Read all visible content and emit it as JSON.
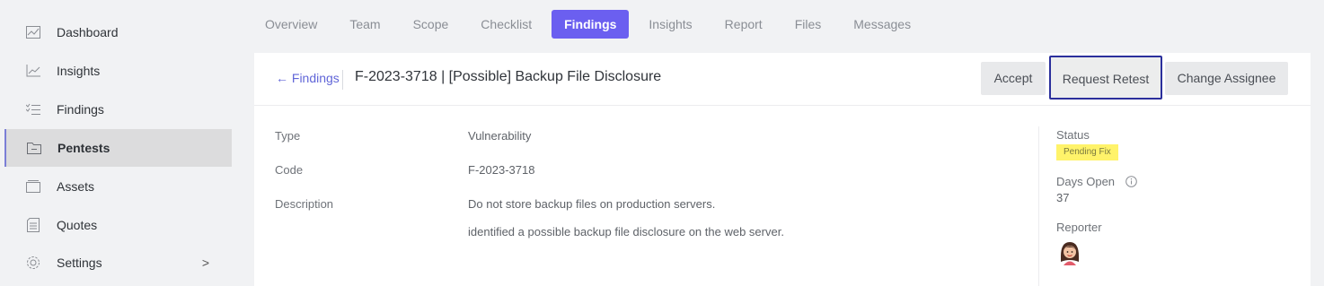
{
  "sidebar": {
    "items": [
      {
        "label": "Dashboard",
        "icon": "dashboard-icon"
      },
      {
        "label": "Insights",
        "icon": "chart-line-icon"
      },
      {
        "label": "Findings",
        "icon": "checklist-icon"
      },
      {
        "label": "Pentests",
        "icon": "folder-icon",
        "active": true
      },
      {
        "label": "Assets",
        "icon": "assets-icon"
      },
      {
        "label": "Quotes",
        "icon": "quotes-icon"
      },
      {
        "label": "Settings",
        "icon": "gear-icon",
        "chevron": ">"
      }
    ]
  },
  "tabs": [
    {
      "label": "Overview"
    },
    {
      "label": "Team"
    },
    {
      "label": "Scope"
    },
    {
      "label": "Checklist"
    },
    {
      "label": "Findings",
      "active": true
    },
    {
      "label": "Insights"
    },
    {
      "label": "Report"
    },
    {
      "label": "Files"
    },
    {
      "label": "Messages"
    }
  ],
  "header": {
    "back_label": "← Findings",
    "title": "F-2023-3718 | [Possible] Backup File Disclosure",
    "accept_label": "Accept",
    "retest_label": "Request Retest",
    "assignee_label": "Change Assignee"
  },
  "details": {
    "type_label": "Type",
    "type_value": "Vulnerability",
    "code_label": "Code",
    "code_value": "F-2023-3718",
    "description_label": "Description",
    "description_line1": "Do not store backup files on production servers.",
    "description_line2": "identified a possible backup file disclosure on the web server."
  },
  "status_panel": {
    "status_label": "Status",
    "status_value": "Pending Fix",
    "days_open_label": "Days Open",
    "days_open_value": "37",
    "reporter_label": "Reporter"
  },
  "colors": {
    "accent": "#6b5ff0",
    "link": "#6166d8",
    "badge_bg": "#fff36a",
    "focus_outline": "#2b2f9c"
  }
}
